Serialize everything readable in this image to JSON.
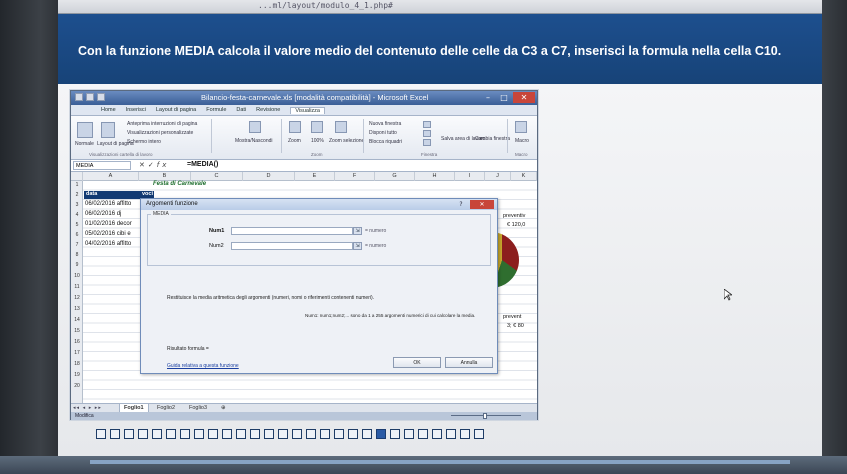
{
  "browser": {
    "url": "...ml/layout/modulo_4_1.php#"
  },
  "slide": {
    "title": "Con la funzione MEDIA calcola il valore medio del contenuto delle celle da C3 a C7, inserisci la formula nella cella C10."
  },
  "excel": {
    "title": "Bilancio-festa-carnevale.xls [modalità compatibilità] - Microsoft Excel",
    "tabs": [
      "Home",
      "Inserisci",
      "Layout di pagina",
      "Formule",
      "Dati",
      "Revisione",
      "Visualizza"
    ],
    "active_tab": "Visualizza",
    "ribbon": {
      "normal": "Normale",
      "layout": "Layout di pagina",
      "page_break": "Anteprima interruzioni di pagina",
      "custom_views": "Visualizzazioni personalizzate",
      "full_screen": "Schermo intero",
      "views_group": "Visualizzazioni cartella di lavoro",
      "show_hide": "Mostra/Nascondi",
      "zoom": "Zoom",
      "zoom100": "100%",
      "zoom_sel": "Zoom selezione",
      "zoom_group": "Zoom",
      "new_window": "Nuova finestra",
      "arrange_all": "Disponi tutto",
      "freeze": "Blocca riquadri",
      "save_ws": "Salva area di lavoro",
      "switch": "Cambia finestra",
      "window_group": "Finestra",
      "macro": "Macro",
      "macro_group": "Macro"
    },
    "name_box": "MEDIA",
    "formula": "=MEDIA()",
    "columns": [
      "A",
      "B",
      "C",
      "D",
      "E",
      "F",
      "G",
      "H",
      "I",
      "J",
      "K"
    ],
    "rows": [
      "1",
      "2",
      "3",
      "4",
      "5",
      "6",
      "7",
      "8",
      "9",
      "10",
      "11",
      "12",
      "13",
      "14",
      "15",
      "16",
      "17",
      "18",
      "19",
      "20"
    ],
    "cells": {
      "title": "Festa di Carnevale",
      "h_data": "data",
      "h_voci": "voci s",
      "r3": "06/02/2016 affitto",
      "r4": "06/02/2016 dj",
      "r5": "01/02/2016 decor",
      "r6": "05/02/2016 cibi e",
      "r7": "04/02/2016 affitto",
      "total": "totale",
      "right1": "preventiv",
      "right2": "€ 120,0",
      "right3": "prevent",
      "right4": "3; € 80"
    },
    "sheets": [
      "Foglio1",
      "Foglio2",
      "Foglio3"
    ],
    "active_sheet": "Foglio1",
    "status": "Modifica"
  },
  "dialog": {
    "title": "Argomenti funzione",
    "function_name": "MEDIA",
    "arg1_label": "Num1",
    "arg2_label": "Num2",
    "arg1_result": "= numero",
    "arg2_result": "= numero",
    "description": "Restituisce la media aritmetica degli argomenti (numeri, nomi o riferimenti contenenti numeri).",
    "arg_description": "Num1: num1;num2;... sono da 1 a 255 argomenti numerici di cui calcolare la media.",
    "result": "Risultato formula =",
    "help_link": "Guida relativa a questa funzione",
    "ok": "OK",
    "cancel": "Annulla"
  },
  "pager": {
    "count": 28,
    "active_index": 20
  }
}
